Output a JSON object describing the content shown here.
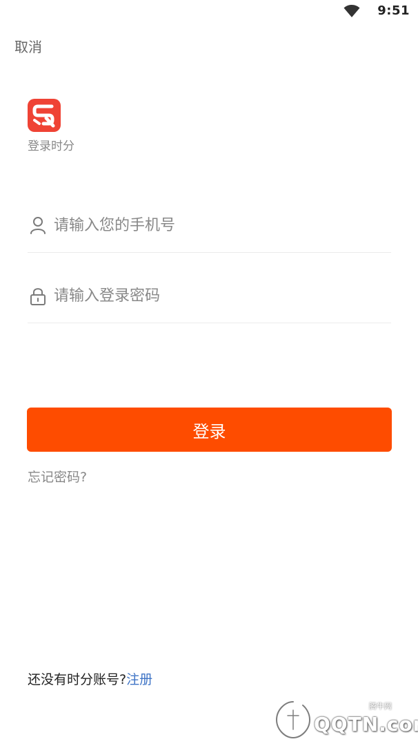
{
  "status_bar": {
    "time": "9:51",
    "wifi_icon": "wifi-icon"
  },
  "header": {
    "cancel_label": "取消"
  },
  "app": {
    "logo_icon": "sr-logo",
    "subtitle": "登录时分",
    "brand_color": "#ef4335"
  },
  "form": {
    "phone": {
      "icon": "user-icon",
      "placeholder": "请输入您的手机号",
      "value": ""
    },
    "password": {
      "icon": "lock-icon",
      "placeholder": "请输入登录密码",
      "value": ""
    },
    "login_label": "登录",
    "login_color": "#fe4c00",
    "forgot_label": "忘记密码?"
  },
  "footer": {
    "register_prompt": "还没有时分账号?",
    "register_link": "注册",
    "link_color": "#3f74c6"
  },
  "watermark": {
    "text": "QQTN.com",
    "small_text": "腾牛网"
  }
}
